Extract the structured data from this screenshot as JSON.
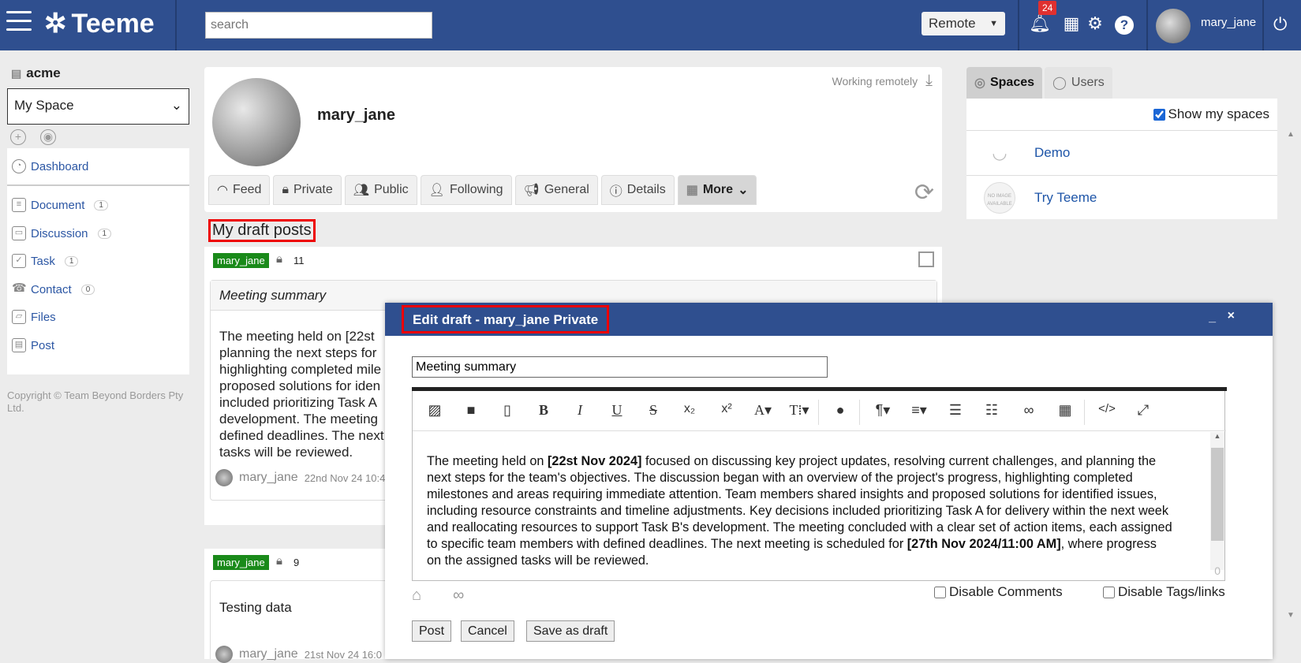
{
  "header": {
    "app_name": "Teeme",
    "search_placeholder": "search",
    "remote_label": "Remote",
    "notification_count": "24",
    "help_label": "?",
    "username": "mary_jane"
  },
  "sidebar": {
    "org": "acme",
    "space_select": "My Space",
    "dashboard": "Dashboard",
    "items": [
      {
        "label": "Document",
        "count": "1"
      },
      {
        "label": "Discussion",
        "count": "1"
      },
      {
        "label": "Task",
        "count": "1"
      },
      {
        "label": "Contact",
        "count": "0"
      },
      {
        "label": "Files",
        "count": ""
      },
      {
        "label": "Post",
        "count": ""
      }
    ],
    "copyright": "Copyright © Team Beyond Borders Pty Ltd."
  },
  "profile": {
    "name": "mary_jane",
    "status": "Working remotely",
    "tabs": [
      "Feed",
      "Private",
      "Public",
      "Following",
      "General",
      "Details",
      "More"
    ]
  },
  "drafts": {
    "heading": "My draft posts",
    "post1": {
      "author": "mary_jane",
      "count": "11",
      "subject": "Meeting summary",
      "body_lines": [
        "The meeting held on [22st",
        "planning the next steps for",
        "highlighting completed mile",
        "proposed solutions for iden",
        "included prioritizing Task A",
        "development. The meeting",
        "defined deadlines. The next",
        "tasks will be reviewed."
      ],
      "footer_author": "mary_jane",
      "footer_date": "22nd Nov 24 10:4"
    },
    "post2": {
      "author": "mary_jane",
      "count": "9",
      "body": "Testing data",
      "footer_author": "mary_jane",
      "footer_date": "21st Nov 24 16:0"
    }
  },
  "right_panel": {
    "tab_spaces": "Spaces",
    "tab_users": "Users",
    "show_my_spaces": "Show my spaces",
    "spaces": [
      {
        "name": "Demo",
        "logo_text": ""
      },
      {
        "name": "Try Teeme",
        "logo_text": "NO IMAGE AVAILABLE"
      }
    ]
  },
  "modal": {
    "title": "Edit draft - mary_jane Private",
    "minimize": "_",
    "close": "×",
    "subject_value": "Meeting summary",
    "body_parts": {
      "p1": "The meeting held on ",
      "b1": "[22st Nov 2024]",
      "p2": " focused on discussing key project updates, resolving current challenges, and planning the next steps for the team's objectives. The discussion began with an overview of the project's progress, highlighting completed milestones and areas requiring immediate attention. Team members shared insights and proposed solutions for identified issues, including resource constraints and timeline adjustments. Key decisions included prioritizing Task A for delivery within the next week and reallocating resources to support Task B's development. The meeting concluded with a clear set of action items, each assigned to specific team members with defined deadlines. The next meeting is scheduled for ",
      "b2": "[27th Nov 2024/11:00 AM]",
      "p3": ", where progress on the assigned tasks will be reviewed."
    },
    "char_count": "0",
    "disable_comments": "Disable Comments",
    "disable_tags": "Disable Tags/links",
    "btn_post": "Post",
    "btn_cancel": "Cancel",
    "btn_save_draft": "Save as draft"
  },
  "colors": {
    "header_bg": "#2f4f8f",
    "highlight_border": "#e00000",
    "author_tag": "#1a8a1a",
    "link": "#2c57a4"
  }
}
